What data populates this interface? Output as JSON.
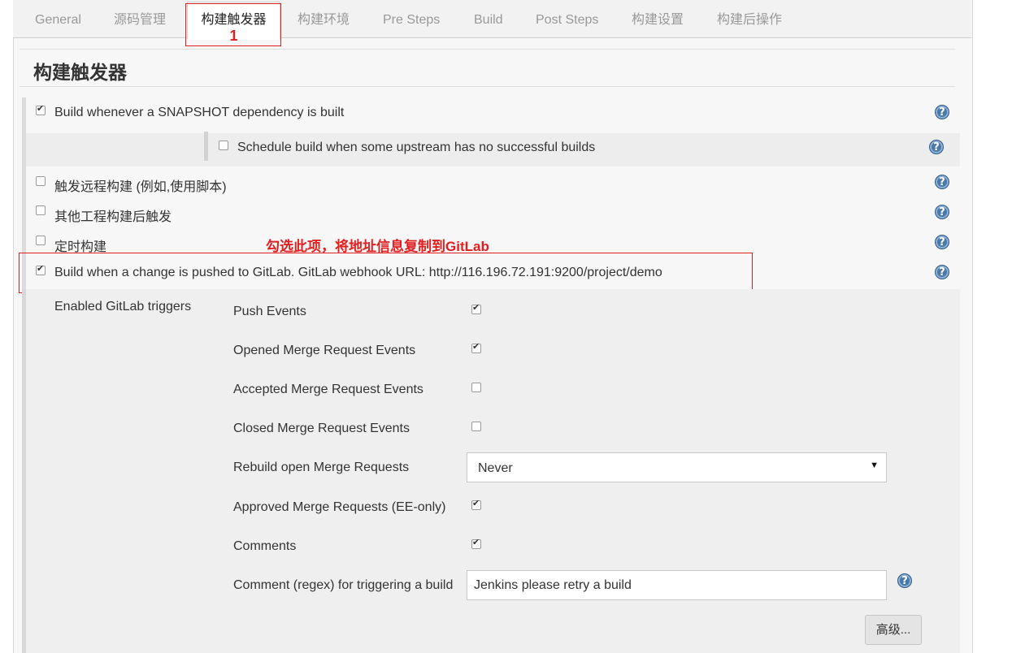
{
  "tabs": [
    {
      "label": "General"
    },
    {
      "label": "源码管理"
    },
    {
      "label": "构建触发器",
      "annotation": "1"
    },
    {
      "label": "构建环境"
    },
    {
      "label": "Pre Steps"
    },
    {
      "label": "Build"
    },
    {
      "label": "Post Steps"
    },
    {
      "label": "构建设置"
    },
    {
      "label": "构建后操作"
    }
  ],
  "section": {
    "title": "构建触发器"
  },
  "triggers": {
    "snapshot": {
      "label": "Build whenever a SNAPSHOT dependency is built",
      "checked": true
    },
    "schedule_upstream": {
      "label": "Schedule build when some upstream has no successful builds",
      "checked": false
    },
    "remote": {
      "label": "触发远程构建 (例如,使用脚本)",
      "checked": false
    },
    "after_other": {
      "label": "其他工程构建后触发",
      "checked": false
    },
    "timed": {
      "label": "定时构建",
      "checked": false
    },
    "gitlab": {
      "label": "Build when a change is pushed to GitLab. GitLab webhook URL: http://116.196.72.191:9200/project/demo",
      "checked": true
    }
  },
  "annotation_text": "勾选此项，将地址信息复制到GitLab",
  "gitlab": {
    "enabled_label": "Enabled GitLab triggers",
    "events": [
      {
        "label": "Push Events",
        "checked": true
      },
      {
        "label": "Opened Merge Request Events",
        "checked": true
      },
      {
        "label": "Accepted Merge Request Events",
        "checked": false
      },
      {
        "label": "Closed Merge Request Events",
        "checked": false
      }
    ],
    "rebuild": {
      "label": "Rebuild open Merge Requests",
      "value": "Never"
    },
    "approved": {
      "label": "Approved Merge Requests (EE-only)",
      "checked": true
    },
    "comments": {
      "label": "Comments",
      "checked": true
    },
    "comment_regex": {
      "label": "Comment (regex) for triggering a build",
      "value": "Jenkins please retry a build"
    },
    "advanced_label": "高级..."
  },
  "help_glyph": "?",
  "select_arrow": "▼",
  "colors": {
    "annotation": "#e02020",
    "help": "#4a78a8"
  }
}
